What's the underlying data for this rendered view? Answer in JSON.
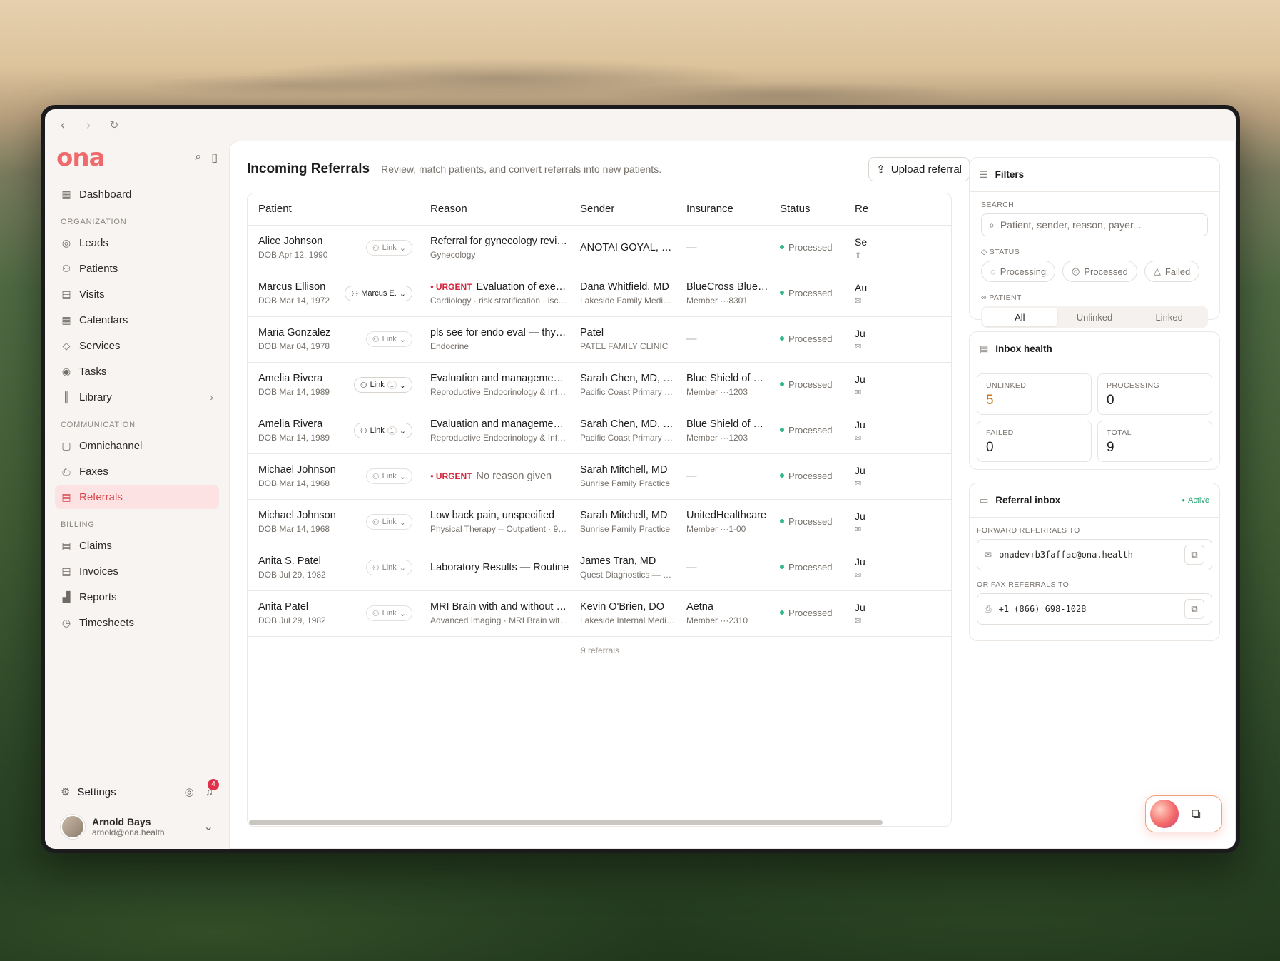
{
  "browser": {
    "back": "‹",
    "forward": "›",
    "reload": "↻"
  },
  "brand": {
    "logo": "ona"
  },
  "sidebar": {
    "dashboard": "Dashboard",
    "org_label": "ORGANIZATION",
    "org_items": [
      "Leads",
      "Patients",
      "Visits",
      "Calendars",
      "Services",
      "Tasks",
      "Library"
    ],
    "comm_label": "COMMUNICATION",
    "comm_items": [
      "Omnichannel",
      "Faxes",
      "Referrals"
    ],
    "billing_label": "BILLING",
    "billing_items": [
      "Claims",
      "Invoices",
      "Reports",
      "Timesheets"
    ],
    "active": "Referrals",
    "settings": "Settings",
    "notification_count": "4",
    "user": {
      "name": "Arnold Bays",
      "email": "arnold@ona.health"
    }
  },
  "header": {
    "title": "Incoming Referrals",
    "subtitle": "Review, match patients, and convert referrals into new patients.",
    "upload_label": "Upload referral"
  },
  "table": {
    "columns": [
      "Patient",
      "Reason",
      "Sender",
      "Insurance",
      "Status",
      "Re"
    ],
    "rows": [
      {
        "name": "Alice Johnson",
        "dob": "DOB Apr 12, 1990",
        "link": "Link",
        "link_count": "",
        "urgent": "",
        "reason": "Referral for gynecology review.",
        "reason_sub": "Gynecology",
        "sender": "ANOTAI GOYAL, MPT",
        "sender_sub": "",
        "insurance": "—",
        "insurance_sub": "",
        "status": "Processed",
        "rec": "Se",
        "rec_icon": "⇧"
      },
      {
        "name": "Marcus Ellison",
        "dob": "DOB Mar 14, 1972",
        "link": "Marcus E.",
        "link_count": "",
        "urgent": "URGENT",
        "reason": "Evaluation of exertio…",
        "reason_sub": "Cardiology · risk stratification · ische…",
        "sender": "Dana Whitfield, MD",
        "sender_sub": "Lakeside Family Medicine",
        "insurance": "BlueCross BlueS…",
        "insurance_sub": "Member ···8301",
        "status": "Processed",
        "rec": "Au",
        "rec_icon": "✉"
      },
      {
        "name": "Maria Gonzalez",
        "dob": "DOB Mar 04, 1978",
        "link": "Link",
        "link_count": "",
        "urgent": "",
        "reason": "pls see for endo eval — thyroid?",
        "reason_sub": "Endocrine",
        "sender": "Patel",
        "sender_sub": "PATEL FAMILY CLINIC",
        "insurance": "—",
        "insurance_sub": "",
        "status": "Processed",
        "rec": "Ju",
        "rec_icon": "✉"
      },
      {
        "name": "Amelia Rivera",
        "dob": "DOB Mar 14, 1989",
        "link": "Link",
        "link_count": "1",
        "urgent": "",
        "reason": "Evaluation and management o…",
        "reason_sub": "Reproductive Endocrinology & Infert…",
        "sender": "Sarah Chen, MD, Bo…",
        "sender_sub": "Pacific Coast Primary C…",
        "insurance": "Blue Shield of Cal…",
        "insurance_sub": "Member ···1203",
        "status": "Processed",
        "rec": "Ju",
        "rec_icon": "✉"
      },
      {
        "name": "Amelia Rivera",
        "dob": "DOB Mar 14, 1989",
        "link": "Link",
        "link_count": "1",
        "urgent": "",
        "reason": "Evaluation and management o…",
        "reason_sub": "Reproductive Endocrinology & Infert…",
        "sender": "Sarah Chen, MD, Bo…",
        "sender_sub": "Pacific Coast Primary C…",
        "insurance": "Blue Shield of Cal…",
        "insurance_sub": "Member ···1203",
        "status": "Processed",
        "rec": "Ju",
        "rec_icon": "✉"
      },
      {
        "name": "Michael Johnson",
        "dob": "DOB Mar 14, 1968",
        "link": "Link",
        "link_count": "",
        "urgent": "URGENT",
        "reason": "No reason given",
        "reason_sub": "",
        "sender": "Sarah Mitchell, MD",
        "sender_sub": "Sunrise Family Practice",
        "insurance": "—",
        "insurance_sub": "",
        "status": "Processed",
        "rec": "Ju",
        "rec_icon": "✉"
      },
      {
        "name": "Michael Johnson",
        "dob": "DOB Mar 14, 1968",
        "link": "Link",
        "link_count": "",
        "urgent": "",
        "reason": "Low back pain, unspecified",
        "reason_sub": "Physical Therapy -- Outpatient · 9711…",
        "sender": "Sarah Mitchell, MD",
        "sender_sub": "Sunrise Family Practice",
        "insurance": "UnitedHealthcare",
        "insurance_sub": "Member ···1-00",
        "status": "Processed",
        "rec": "Ju",
        "rec_icon": "✉"
      },
      {
        "name": "Anita S. Patel",
        "dob": "DOB Jul 29, 1982",
        "link": "Link",
        "link_count": "",
        "urgent": "",
        "reason": "Laboratory Results — Routine",
        "reason_sub": "",
        "sender": "James Tran, MD",
        "sender_sub": "Quest Diagnostics — Le…",
        "insurance": "—",
        "insurance_sub": "",
        "status": "Processed",
        "rec": "Ju",
        "rec_icon": "✉"
      },
      {
        "name": "Anita Patel",
        "dob": "DOB Jul 29, 1982",
        "link": "Link",
        "link_count": "",
        "urgent": "",
        "reason": "MRI Brain with and without con…",
        "reason_sub": "Advanced Imaging · MRI Brain with an…",
        "sender": "Kevin O'Brien, DO",
        "sender_sub": "Lakeside Internal Medici…",
        "insurance": "Aetna",
        "insurance_sub": "Member ···2310",
        "status": "Processed",
        "rec": "Ju",
        "rec_icon": "✉"
      }
    ],
    "footer": "9 referrals"
  },
  "filters": {
    "title": "Filters",
    "search_label": "SEARCH",
    "search_placeholder": "Patient, sender, reason, payer...",
    "status_label": "STATUS",
    "status_chips": [
      "Processing",
      "Processed",
      "Failed"
    ],
    "patient_label": "PATIENT",
    "patient_segments": [
      "All",
      "Unlinked",
      "Linked"
    ],
    "patient_selected": "All"
  },
  "inbox_health": {
    "title": "Inbox health",
    "stats": [
      {
        "label": "UNLINKED",
        "value": "5"
      },
      {
        "label": "PROCESSING",
        "value": "0"
      },
      {
        "label": "FAILED",
        "value": "0"
      },
      {
        "label": "TOTAL",
        "value": "9"
      }
    ]
  },
  "referral_inbox": {
    "title": "Referral inbox",
    "status": "Active",
    "forward_label": "FORWARD REFERRALS TO",
    "email": "onadev+b3faffac@ona.health",
    "fax_label": "OR FAX REFERRALS TO",
    "fax": "+1 (866) 698-1028"
  },
  "colors": {
    "brand": "#ef6a6d",
    "active_bg": "#fde2e3",
    "urgent": "#d5243a",
    "processed_dot": "#33b888",
    "warn_value": "#c9761a"
  }
}
